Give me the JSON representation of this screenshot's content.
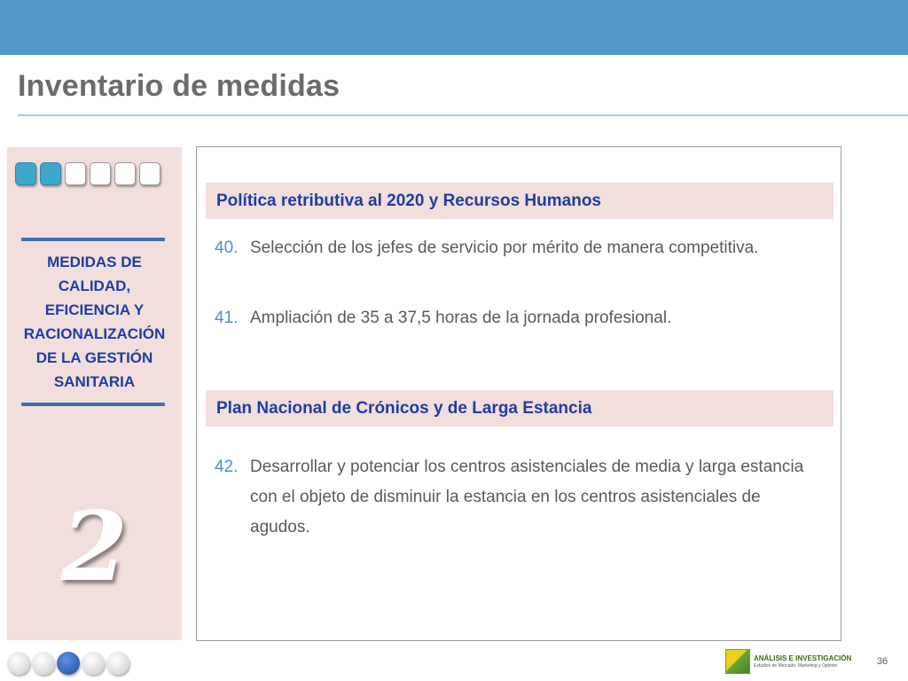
{
  "header": {
    "title": "Inventario de medidas"
  },
  "sidebar": {
    "progress_squares": [
      true,
      true,
      false,
      false,
      false,
      false
    ],
    "heading": "MEDIDAS DE\nCALIDAD,\nEFICIENCIA Y\nRACIONALIZACIÓN\nDE LA GESTIÓN\nSANITARIA",
    "number": "2"
  },
  "sections": [
    {
      "title": "Política retributiva al 2020 y Recursos Humanos",
      "items": [
        {
          "num": "40.",
          "text": "Selección de los jefes de servicio por mérito de manera competitiva."
        },
        {
          "num": "41.",
          "text": "Ampliación de 35 a 37,5 horas de la jornada profesional."
        }
      ]
    },
    {
      "title": "Plan Nacional de Crónicos y de Larga Estancia",
      "items": [
        {
          "num": "42.",
          "text": "Desarrollar y potenciar los centros asistenciales  de media y larga estancia con el objeto de disminuir la estancia en los centros asistenciales de agudos."
        }
      ]
    }
  ],
  "footer": {
    "nav_dots": [
      false,
      false,
      true,
      false,
      false
    ],
    "logo_title": "ANÁLISIS E INVESTIGACIÓN",
    "logo_subtitle": "Estudios de Mercado, Marketing y Opinión",
    "page_number": "36"
  },
  "colors": {
    "topbar": "#5499c7",
    "accent_blue": "#1c3fa0",
    "number_blue": "#4a90d0",
    "panel_pink": "#f3dede"
  }
}
